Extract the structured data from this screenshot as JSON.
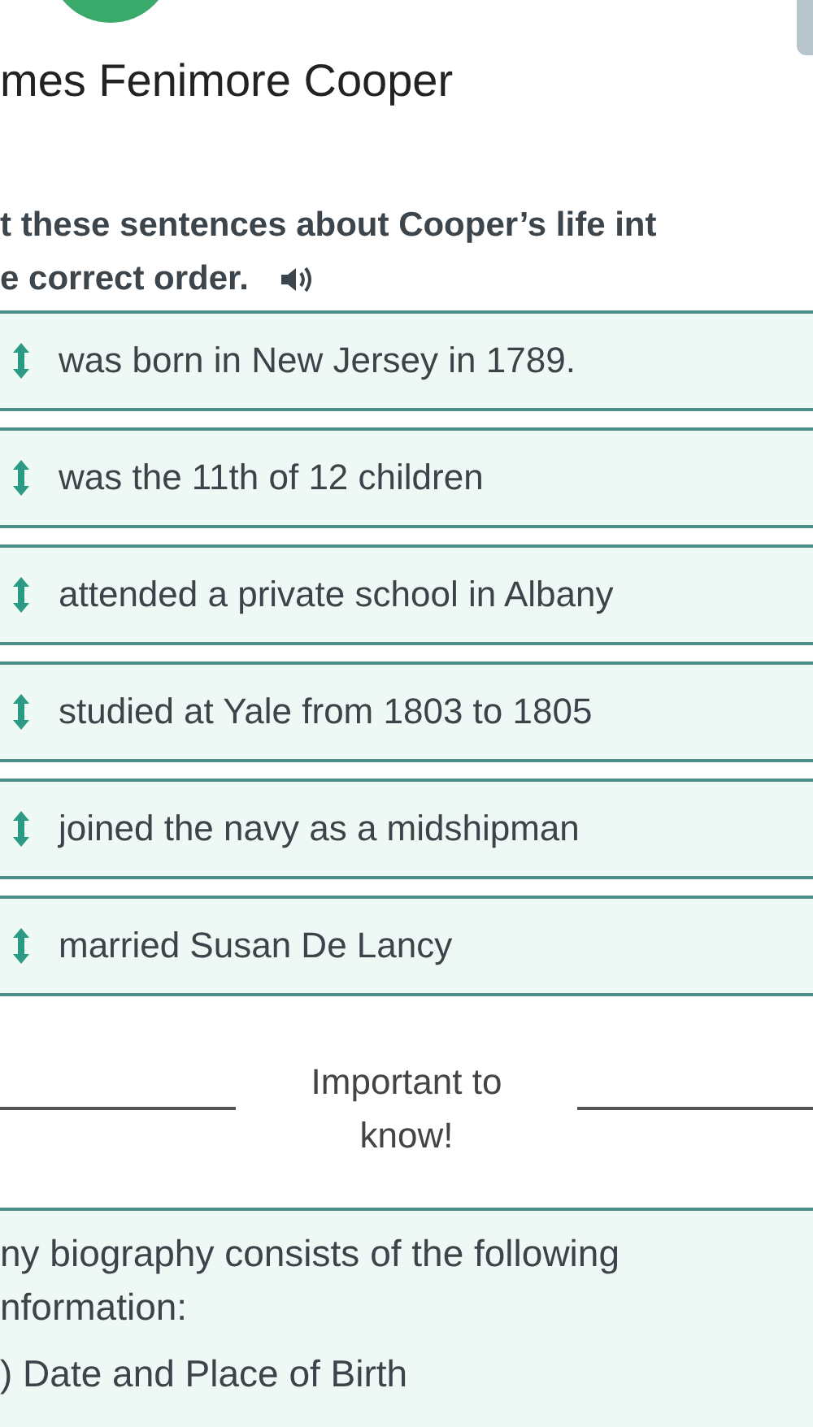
{
  "header": {
    "title": "mes Fenimore Cooper"
  },
  "instruction": {
    "lines": [
      "t these sentences about Cooper’s life int",
      "e correct order."
    ]
  },
  "items": [
    {
      "text": "was born in New Jersey in 1789."
    },
    {
      "text": "was the 11th of 12 children"
    },
    {
      "text": "attended a private school in Albany"
    },
    {
      "text": "studied at Yale from 1803 to 1805"
    },
    {
      "text": "joined the navy as a midshipman"
    },
    {
      "text": "married Susan De Lancy"
    }
  ],
  "divider": {
    "label": "Important to know!"
  },
  "info": {
    "paragraphs": [
      {
        "lines": [
          "ny biography consists of the following",
          "nformation:"
        ]
      },
      {
        "lines": [
          ") Date and Place of Birth"
        ]
      }
    ]
  }
}
